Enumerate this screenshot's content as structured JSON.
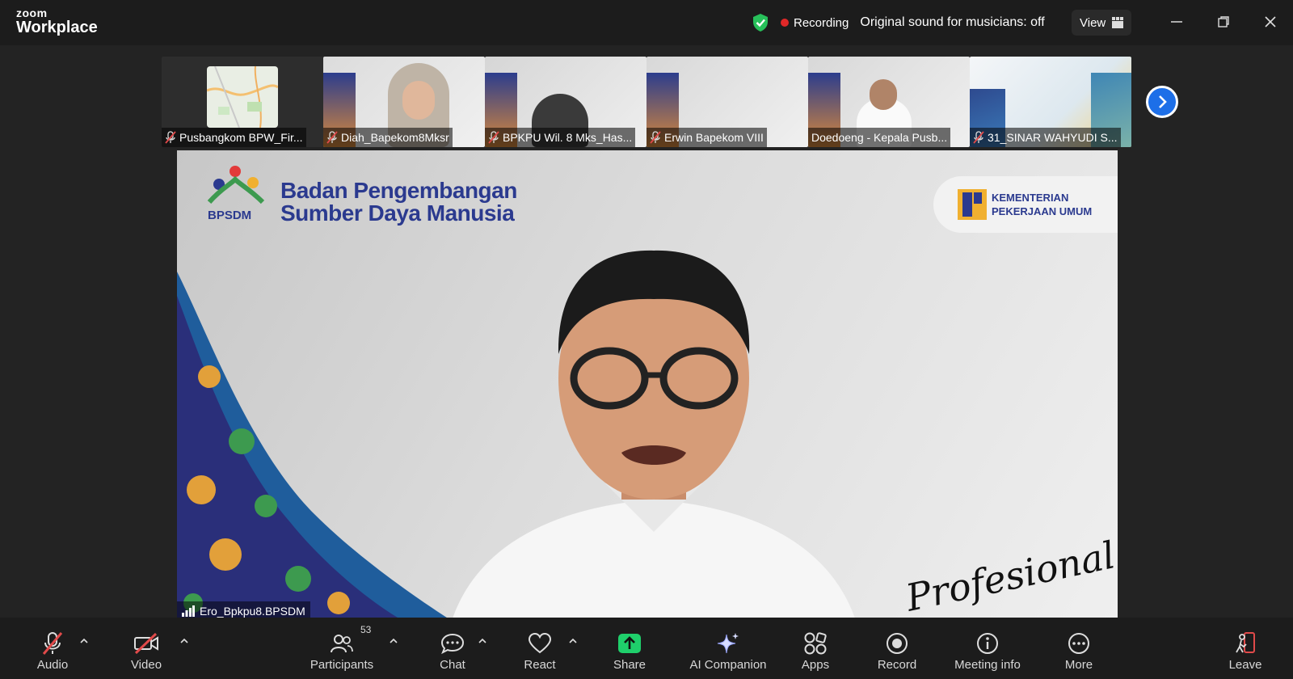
{
  "app": {
    "brand_top": "zoom",
    "brand_bottom": "Workplace"
  },
  "status": {
    "recording_label": "Recording",
    "sound_label": "Original sound for musicians: off",
    "view_label": "View"
  },
  "thumbnails": [
    {
      "name": "Pusbangkom BPW_Fir..."
    },
    {
      "name": "Diah_Bapekom8Mksr"
    },
    {
      "name": "BPKPU Wil. 8 Mks_Has..."
    },
    {
      "name": "Erwin Bapekom VIII"
    },
    {
      "name": "Doedoeng - Kepala Pusb..."
    },
    {
      "name": "31_SINAR WAHYUDI S..."
    }
  ],
  "speaker": {
    "name": "Ero_Bpkpu8.BPSDM",
    "bg_org_line1": "Badan Pengembangan",
    "bg_org_line2": "Sumber Daya Manusia",
    "bg_logo_text": "BPSDM",
    "bg_ministry_line1": "KEMENTERIAN",
    "bg_ministry_line2": "PEKERJAAN UMUM",
    "bg_slogan": "Profesional"
  },
  "toolbar": {
    "audio": "Audio",
    "video": "Video",
    "participants": "Participants",
    "participants_count": "53",
    "chat": "Chat",
    "react": "React",
    "share": "Share",
    "ai_companion": "AI Companion",
    "apps": "Apps",
    "record": "Record",
    "meeting_info": "Meeting info",
    "more": "More",
    "leave": "Leave"
  },
  "colors": {
    "accent_blue": "#1d6fe8",
    "share_green": "#1fcf6b",
    "recording_red": "#e02828",
    "muted_red": "#e04a4a",
    "brand_navy": "#2b3a8f"
  }
}
